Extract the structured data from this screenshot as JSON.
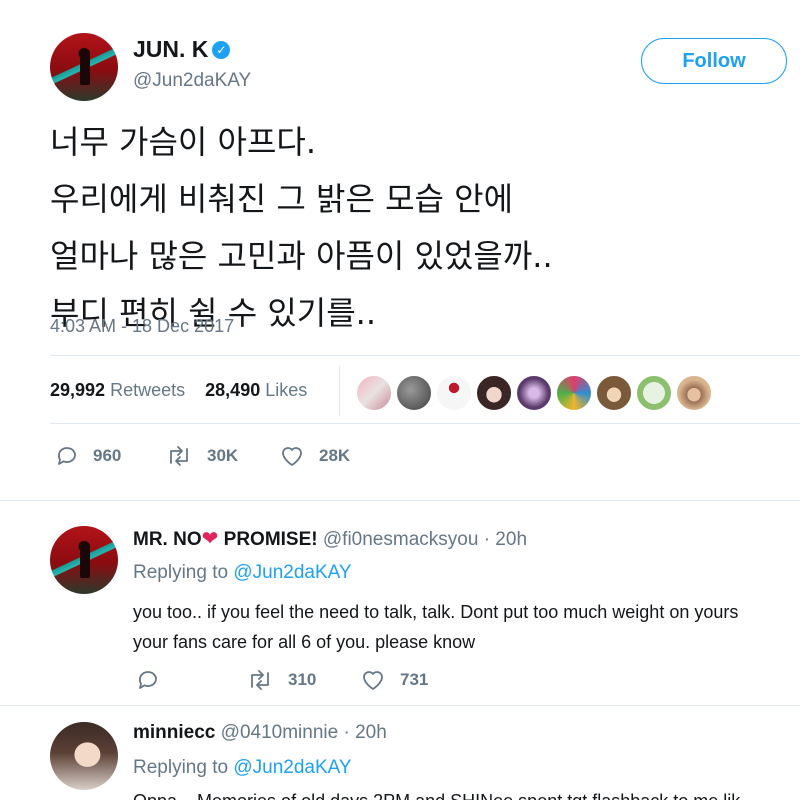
{
  "main_tweet": {
    "author_name": "JUN. K",
    "handle": "@Jun2daKAY",
    "follow_label": "Follow",
    "text_lines": [
      "너무 가슴이 아프다.",
      "우리에게 비춰진 그 밝은 모습 안에",
      "얼마나 많은 고민과 아픔이 있었을까..",
      "부디 편히 쉴 수 있기를.."
    ],
    "timestamp": "4:03 AM - 18 Dec 2017",
    "retweets_count": "29,992",
    "retweets_label": "Retweets",
    "likes_count": "28,490",
    "likes_label": "Likes",
    "actions": {
      "replies": "960",
      "retweets": "30K",
      "likes": "28K"
    }
  },
  "replies": [
    {
      "name_part1": "MR. NO",
      "name_part2": "PROMISE!",
      "handle": "@fi0nesmacksyou",
      "time": "· 20h",
      "replying_prefix": "Replying to",
      "replying_to": "@Jun2daKAY",
      "text_lines": [
        "you too.. if you feel the need to talk, talk. Dont put too much weight on yours",
        "your fans care for all 6 of you. please know"
      ],
      "actions": {
        "retweets": "310",
        "likes": "731"
      }
    },
    {
      "name": "minniecc",
      "handle": "@0410minnie",
      "time": "· 20h",
      "replying_prefix": "Replying to",
      "replying_to": "@Jun2daKAY",
      "text_lines": [
        "Oppa... Memories of old days 2PM and SHINee spent tgt flashback to me lik"
      ]
    }
  ],
  "colors": {
    "accent": "#1da1f2",
    "text": "#14171a",
    "muted": "#657786",
    "divider": "#e1e8ed",
    "heart": "#e0245e"
  },
  "icons": [
    "verified-badge-icon",
    "reply-icon",
    "retweet-icon",
    "heart-icon"
  ]
}
